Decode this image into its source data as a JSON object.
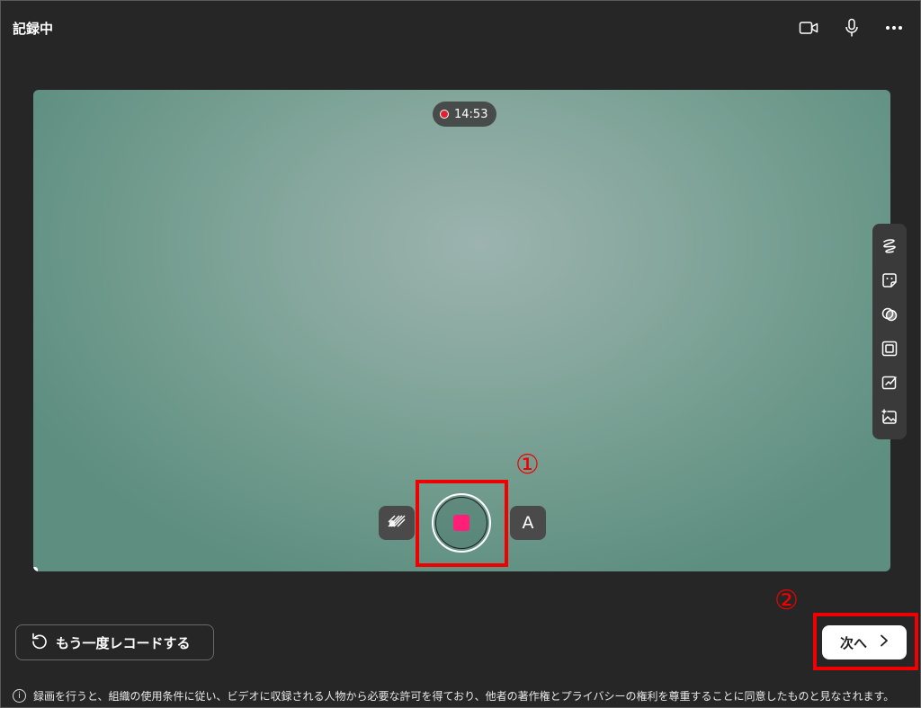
{
  "header": {
    "title": "記録中",
    "icons": [
      "camera-icon",
      "microphone-icon",
      "more-icon"
    ]
  },
  "preview": {
    "timer": "14:53"
  },
  "toolbar": {
    "icons": [
      "ink-icon",
      "sticker-icon",
      "filter-icon",
      "frame-icon",
      "board-icon",
      "add-image-icon"
    ]
  },
  "controls": {
    "left_icon": "background-blur-icon",
    "right_label": "A",
    "record_color": "#ff1e78"
  },
  "annotations": {
    "one": "①",
    "two": "②",
    "color": "#f00000"
  },
  "buttons": {
    "redo_label": "もう一度レコードする",
    "next_label": "次へ",
    "next_arrow": "›"
  },
  "footer": {
    "info_glyph": "i",
    "text": "録画を行うと、組織の使用条件に従い、ビデオに収録される人物から必要な許可を得ており、他者の著作権とプライバシーの権利を尊重することに同意したものと見なされます。"
  }
}
